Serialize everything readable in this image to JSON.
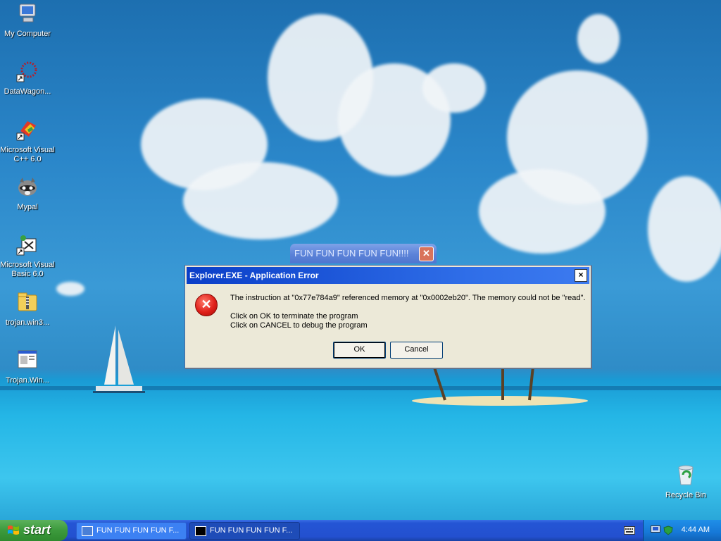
{
  "desktop": {
    "icons": [
      {
        "label": "My Computer"
      },
      {
        "label": "DataWagon..."
      },
      {
        "label": "Microsoft Visual C++ 6.0"
      },
      {
        "label": "Mypal"
      },
      {
        "label": "Microsoft Visual Basic 6.0"
      },
      {
        "label": "trojan.win3..."
      },
      {
        "label": "Trojan.Win..."
      },
      {
        "label": "Recycle Bin"
      }
    ]
  },
  "background_window": {
    "title": "FUN FUN FUN FUN FUN!!!!"
  },
  "dialog": {
    "title": "Explorer.EXE - Application Error",
    "message": "The instruction at \"0x77e784a9\" referenced memory at \"0x0002eb20\". The memory could not be \"read\".",
    "hint_ok": "Click on OK to terminate the program",
    "hint_cancel": "Click on CANCEL to debug the program",
    "ok_label": "OK",
    "cancel_label": "Cancel",
    "close_label": "×"
  },
  "taskbar": {
    "start_label": "start",
    "tasks": [
      {
        "label": "FUN FUN FUN FUN F..."
      },
      {
        "label": "FUN FUN FUN FUN F..."
      }
    ],
    "clock": "4:44 AM"
  }
}
